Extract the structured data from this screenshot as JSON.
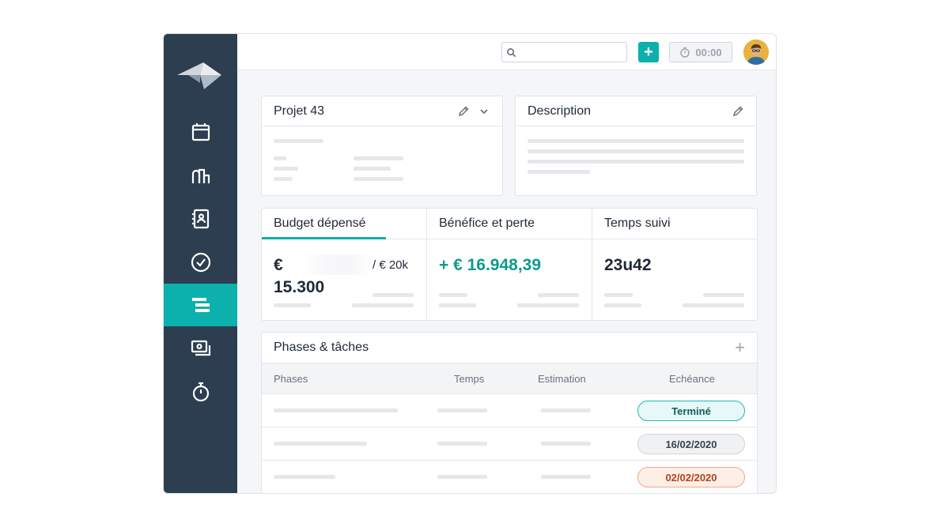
{
  "header": {
    "search": {
      "placeholder": ""
    },
    "add_label": "+",
    "timer": "00:00"
  },
  "sidebar": {
    "items": [
      {
        "icon": "calendar-icon"
      },
      {
        "icon": "buildings-icon"
      },
      {
        "icon": "contacts-icon"
      },
      {
        "icon": "check-circle-icon"
      },
      {
        "icon": "projects-icon",
        "active": true
      },
      {
        "icon": "invoices-icon"
      },
      {
        "icon": "stopwatch-icon"
      }
    ]
  },
  "project_card": {
    "title": "Projet 43"
  },
  "description_card": {
    "title": "Description"
  },
  "metrics": {
    "budget": {
      "label": "Budget dépensé",
      "value_currency": "€",
      "value_amount": "15.300",
      "total": "/ € 20k"
    },
    "profit": {
      "label": "Bénéfice et perte",
      "value": "+ € 16.948,39"
    },
    "time": {
      "label": "Temps suivi",
      "value": "23u42"
    }
  },
  "phases": {
    "title": "Phases & tâches",
    "add_label": "+",
    "columns": [
      "Phases",
      "Temps",
      "Estimation",
      "Echéance"
    ],
    "rows": [
      {
        "status": "Terminé"
      },
      {
        "status": "16/02/2020"
      },
      {
        "status": "02/02/2020"
      }
    ]
  },
  "colors": {
    "accent": "#0cb0ac",
    "sidebar": "#2c3e50",
    "profit": "#0e9a8f",
    "overdue": "#b4431b"
  }
}
